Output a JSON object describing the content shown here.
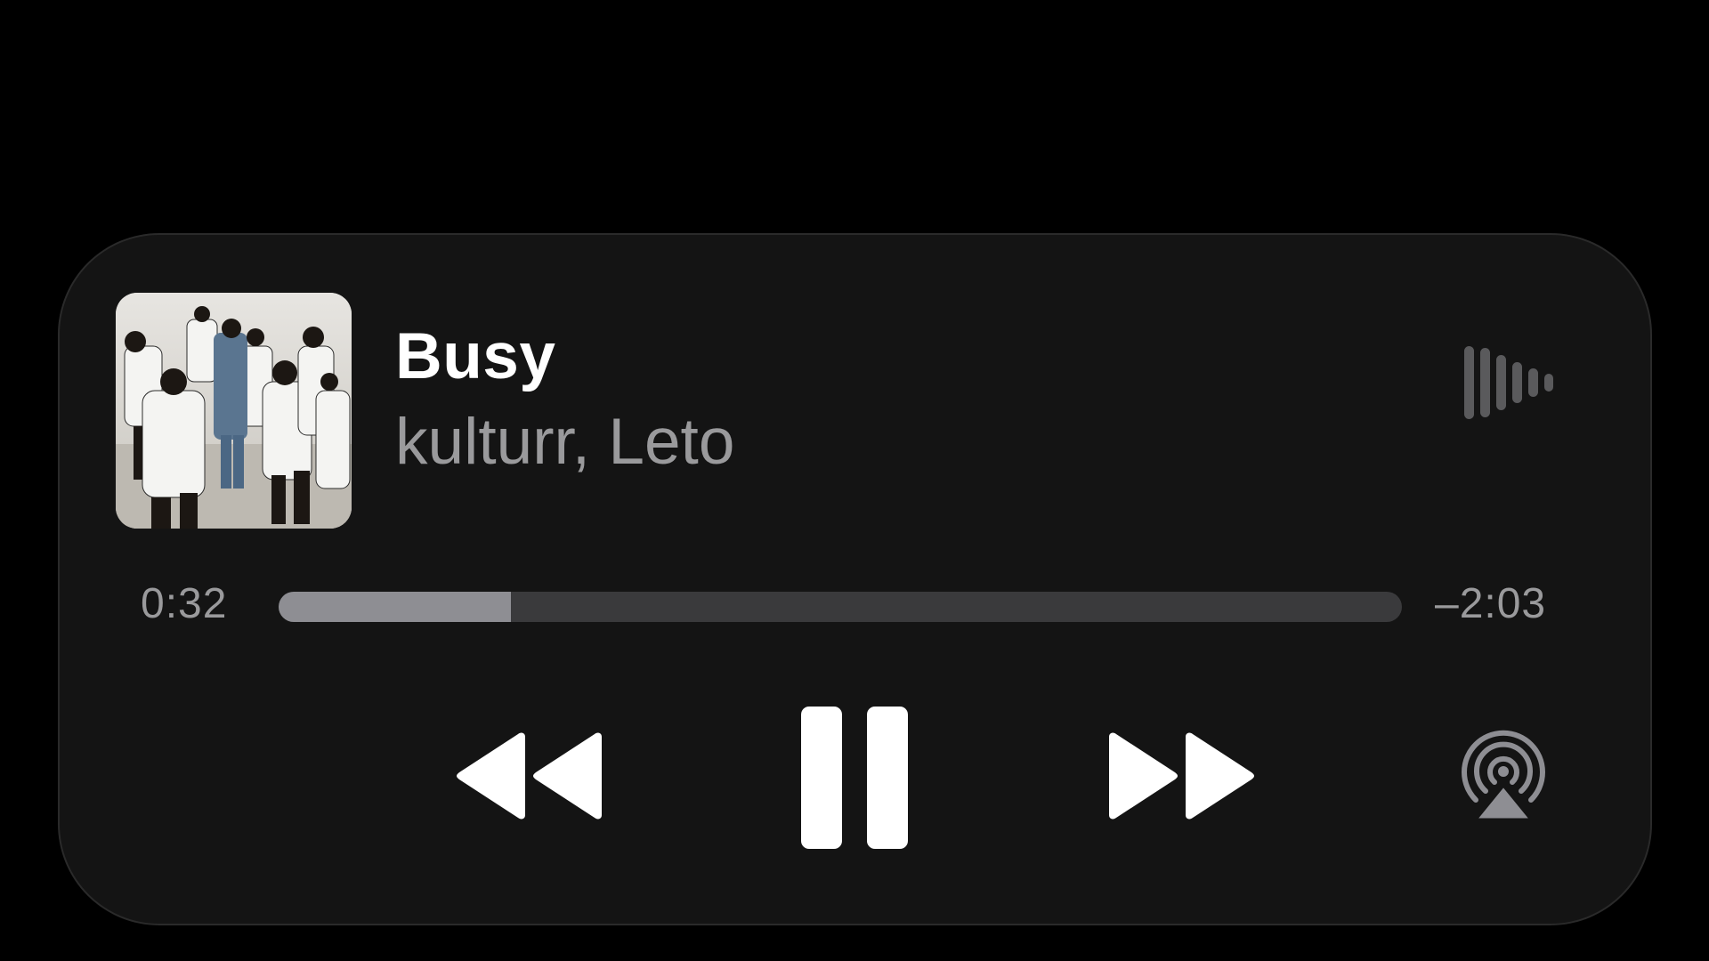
{
  "now_playing": {
    "title": "Busy",
    "artist": "kulturr, Leto",
    "artwork_icon": "album-artwork"
  },
  "progress": {
    "elapsed": "0:32",
    "remaining": "–2:03",
    "fraction": 0.207
  },
  "controls": {
    "rewind_icon": "rewind-icon",
    "pause_icon": "pause-icon",
    "forward_icon": "fast-forward-icon",
    "airplay_icon": "airplay-icon",
    "waveform_icon": "audio-waveform-icon"
  },
  "colors": {
    "background": "#000000",
    "panel": "#141414",
    "primary_text": "#ffffff",
    "secondary_text": "#9a9a9c",
    "track": "#3a3a3c",
    "fill": "#8e8e93"
  }
}
